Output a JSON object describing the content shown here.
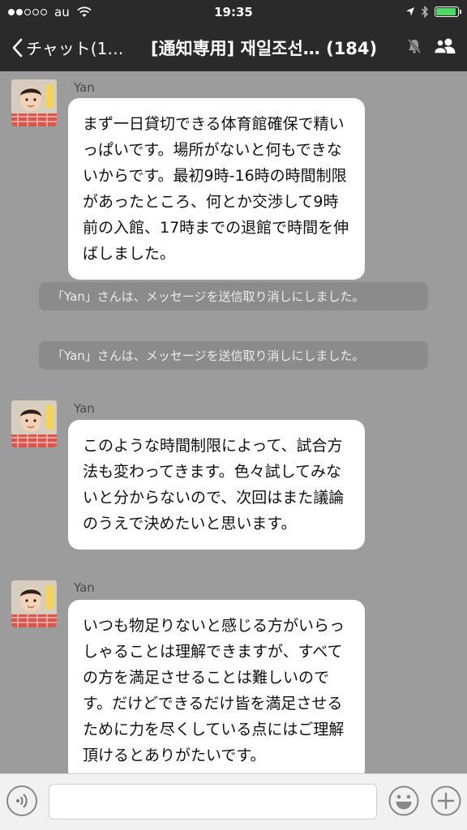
{
  "status": {
    "carrier": "au",
    "time": "19:35"
  },
  "header": {
    "back_label": "チャット(1…",
    "title": "[通知専用] 재일조선… (184)"
  },
  "messages": [
    {
      "sender": "Yan",
      "text": "まず一日貸切できる体育館確保で精いっぱいです。場所がないと何もできないからです。最初9時-16時の時間制限があったところ、何とか交渉して9時前の入館、17時までの退館で時間を伸ばしました。"
    },
    {
      "notice": "「Yan」さんは、メッセージを送信取り消しにしました。"
    },
    {
      "notice": "「Yan」さんは、メッセージを送信取り消しにしました。"
    },
    {
      "sender": "Yan",
      "text": "このような時間制限によって、試合方法も変わってきます。色々試してみないと分からないので、次回はまた議論のうえで決めたいと思います。"
    },
    {
      "sender": "Yan",
      "text": "いつも物足りないと感じる方がいらっしゃることは理解できますが、すべての方を満足させることは難しいのです。だけどできるだけ皆を満足させるために力を尽くしている点にはご理解頂けるとありがたいです。"
    }
  ],
  "input": {
    "placeholder": ""
  },
  "colors": {
    "chat_background": "#9c9c9c",
    "header_background": "#2a2a2a",
    "bubble": "#ffffff",
    "notice": "#8b8b8b",
    "battery": "#4cd964"
  },
  "icons": {
    "back": "chevron-left-icon",
    "mute": "bell-muted-icon",
    "members": "group-icon",
    "voice": "voice-icon",
    "emoji": "smiley-icon",
    "add": "plus-icon"
  }
}
